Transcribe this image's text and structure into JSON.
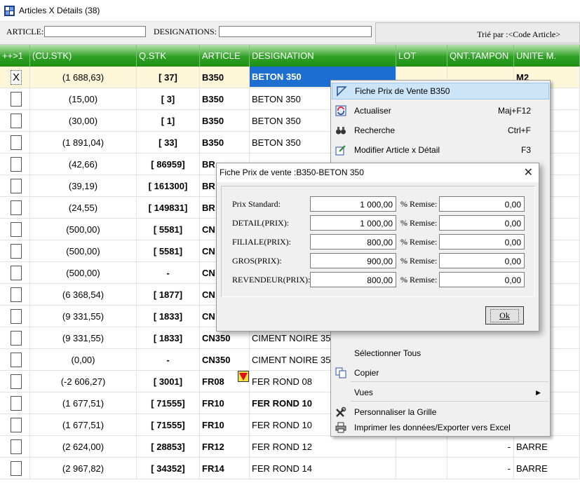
{
  "window": {
    "title": "Articles X Détails (38)"
  },
  "filter": {
    "article_label": "ARTICLE:",
    "article_value": "",
    "designations_label": "DESIGNATIONS:",
    "designations_value": "",
    "sort_text": "Trié par :<Code Article>"
  },
  "columns": [
    "++>1",
    "(CU.STK)",
    "Q.STK",
    "ARTICLE",
    "DESIGNATION",
    "LOT",
    "QNT.TAMPON",
    "UNITE M."
  ],
  "rows": [
    {
      "check": "X",
      "cu": "(1 688,63)",
      "q": "[ 37]",
      "article": "B350",
      "designation": "BETON 350",
      "lot": "",
      "tampon": "",
      "unite": "M2"
    },
    {
      "check": "",
      "cu": "(15,00)",
      "q": "[ 3]",
      "article": "B350",
      "designation": "BETON 350",
      "lot": "",
      "tampon": "",
      "unite": ""
    },
    {
      "check": "",
      "cu": "(30,00)",
      "q": "[ 1]",
      "article": "B350",
      "designation": "BETON 350",
      "lot": "",
      "tampon": "",
      "unite": ""
    },
    {
      "check": "",
      "cu": "(1 891,04)",
      "q": "[ 33]",
      "article": "B350",
      "designation": "BETON 350",
      "lot": "",
      "tampon": "",
      "unite": ""
    },
    {
      "check": "",
      "cu": "(42,66)",
      "q": "[ 86959]",
      "article": "BR",
      "designation": "",
      "lot": "",
      "tampon": "",
      "unite": ""
    },
    {
      "check": "",
      "cu": "(39,19)",
      "q": "[ 161300]",
      "article": "BR",
      "designation": "",
      "lot": "",
      "tampon": "",
      "unite": ""
    },
    {
      "check": "",
      "cu": "(24,55)",
      "q": "[ 149831]",
      "article": "BR",
      "designation": "",
      "lot": "",
      "tampon": "",
      "unite": ""
    },
    {
      "check": "",
      "cu": "(500,00)",
      "q": "[ 5581]",
      "article": "CN",
      "designation": "",
      "lot": "",
      "tampon": "",
      "unite": ""
    },
    {
      "check": "",
      "cu": "(500,00)",
      "q": "[ 5581]",
      "article": "CN",
      "designation": "",
      "lot": "",
      "tampon": "",
      "unite": ""
    },
    {
      "check": "",
      "cu": "(500,00)",
      "q": "-",
      "article": "CN",
      "designation": "",
      "lot": "",
      "tampon": "",
      "unite": ""
    },
    {
      "check": "",
      "cu": "(6 368,54)",
      "q": "[ 1877]",
      "article": "CN",
      "designation": "",
      "lot": "",
      "tampon": "",
      "unite": ""
    },
    {
      "check": "",
      "cu": "(9 331,55)",
      "q": "[ 1833]",
      "article": "CN",
      "designation": "",
      "lot": "",
      "tampon": "",
      "unite": ""
    },
    {
      "check": "",
      "cu": "(9 331,55)",
      "q": "[ 1833]",
      "article": "CN350",
      "designation": "CIMENT NOIRE 35",
      "lot": "",
      "tampon": "",
      "unite": ""
    },
    {
      "check": "",
      "cu": "(0,00)",
      "q": "-",
      "article": "CN350",
      "designation": "CIMENT NOIRE 35",
      "lot": "",
      "tampon": "",
      "unite": ""
    },
    {
      "check": "",
      "cu": "(-2 606,27)",
      "q": "[ 3001]",
      "article": "FR08",
      "designation": "FER ROND 08",
      "lot": "",
      "tampon": "",
      "unite": ""
    },
    {
      "check": "",
      "cu": "(1 677,51)",
      "q": "[ 71555]",
      "article": "FR10",
      "designation": "FER ROND 10",
      "lot": "",
      "tampon": "",
      "unite": ""
    },
    {
      "check": "",
      "cu": "(1 677,51)",
      "q": "[ 71555]",
      "article": "FR10",
      "designation": "FER ROND 10",
      "lot": "",
      "tampon": "",
      "unite": ""
    },
    {
      "check": "",
      "cu": "(2 624,00)",
      "q": "[ 28853]",
      "article": "FR12",
      "designation": "FER ROND 12",
      "lot": "",
      "tampon": "-",
      "unite": "BARRE"
    },
    {
      "check": "",
      "cu": "(2 967,82)",
      "q": "[ 34352]",
      "article": "FR14",
      "designation": "FER ROND 14",
      "lot": "",
      "tampon": "-",
      "unite": "BARRE"
    }
  ],
  "context_menu": {
    "items": [
      {
        "label": "Fiche Prix de Vente B350",
        "shortcut": "",
        "icon": "price-sheet-icon"
      },
      {
        "label": "Actualiser",
        "shortcut": "Maj+F12",
        "icon": "refresh-icon"
      },
      {
        "label": "Recherche",
        "shortcut": "Ctrl+F",
        "icon": "binoculars-icon"
      },
      {
        "label": "Modifier Article x Détail",
        "shortcut": "F3",
        "icon": "edit-icon"
      },
      {
        "label": "Sélectionner Tous",
        "shortcut": "",
        "icon": ""
      },
      {
        "label": "Copier",
        "shortcut": "",
        "icon": "copy-icon"
      },
      {
        "label": "Vues",
        "shortcut": "",
        "icon": ""
      },
      {
        "label": "Personnaliser la Grille",
        "shortcut": "",
        "icon": "tools-icon"
      },
      {
        "label": "Imprimer les données/Exporter vers Excel",
        "shortcut": "",
        "icon": "printer-icon"
      }
    ]
  },
  "dialog": {
    "title": "Fiche Prix de vente :B350-BETON 350",
    "remise_label": "% Remise:",
    "ok_label": "Ok",
    "prices": [
      {
        "label": "Prix Standard:",
        "value": "1 000,00",
        "remise": "0,00"
      },
      {
        "label": "DETAIL(PRIX):",
        "value": "1 000,00",
        "remise": "0,00"
      },
      {
        "label": "FILIALE(PRIX):",
        "value": "800,00",
        "remise": "0,00"
      },
      {
        "label": "GROS(PRIX):",
        "value": "900,00",
        "remise": "0,00"
      },
      {
        "label": "REVENDEUR(PRIX):",
        "value": "800,00",
        "remise": "0,00"
      }
    ]
  },
  "colors": {
    "header_green": "#2ea124",
    "selection_blue": "#1c6fd0",
    "arrow": "#7a1717",
    "menu_highlight": "#cce4f7"
  }
}
